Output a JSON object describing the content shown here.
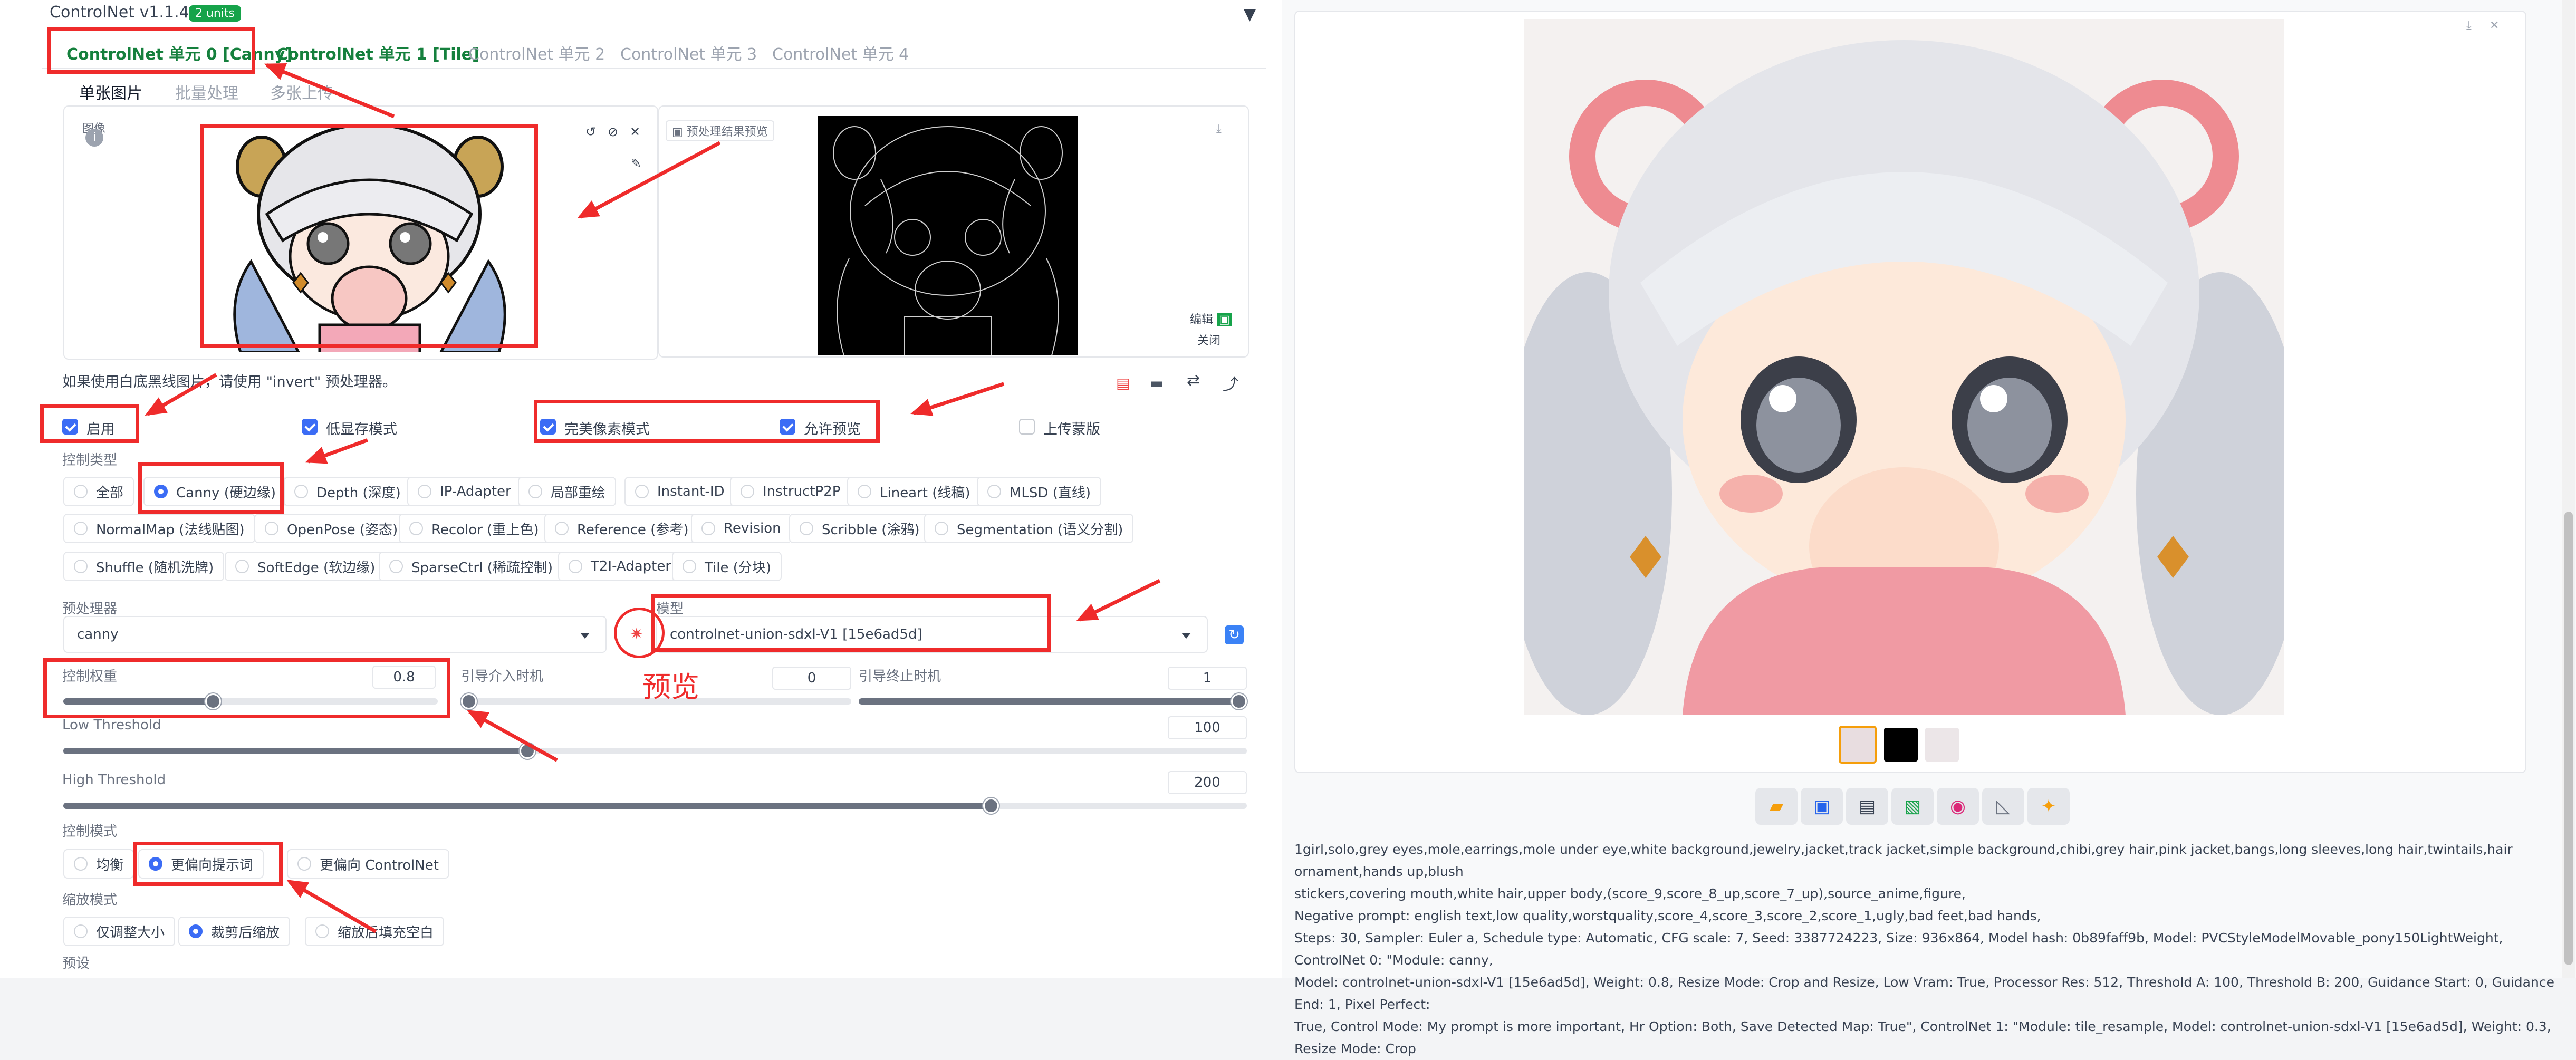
{
  "header": {
    "title": "ControlNet v1.1.445",
    "badge": "2 units"
  },
  "tabs": [
    {
      "label": "ControlNet 单元 0 [Canny]"
    },
    {
      "label": "ControlNet 单元 1 [Tile]"
    },
    {
      "label": "ControlNet 单元 2"
    },
    {
      "label": "ControlNet 单元 3"
    },
    {
      "label": "ControlNet 单元 4"
    }
  ],
  "subtabs": [
    {
      "label": "单张图片"
    },
    {
      "label": "批量处理"
    },
    {
      "label": "多张上传"
    }
  ],
  "image_area": {
    "input_label": "图像",
    "preview_label": "预处理结果预览",
    "edit_label": "编辑",
    "close_label": "关闭"
  },
  "invert_note": "如果使用白底黑线图片，请使用 \"invert\" 预处理器。",
  "checkboxes": [
    {
      "label": "启用",
      "checked": true
    },
    {
      "label": "低显存模式",
      "checked": true
    },
    {
      "label": "完美像素模式",
      "checked": true
    },
    {
      "label": "允许预览",
      "checked": true
    },
    {
      "label": "上传蒙版",
      "checked": false
    }
  ],
  "control_type": {
    "label": "控制类型",
    "rows": [
      [
        "全部",
        "Canny (硬边缘)",
        "Depth (深度)",
        "IP-Adapter",
        "局部重绘",
        "Instant-ID",
        "InstructP2P",
        "Lineart (线稿)",
        "MLSD (直线)"
      ],
      [
        "NormalMap (法线贴图)",
        "OpenPose (姿态)",
        "Recolor (重上色)",
        "Reference (参考)",
        "Revision",
        "Scribble (涂鸦)",
        "Segmentation (语义分割)"
      ],
      [
        "Shuffle (随机洗牌)",
        "SoftEdge (软边缘)",
        "SparseCtrl (稀疏控制)",
        "T2I-Adapter",
        "Tile (分块)"
      ]
    ],
    "selected": "Canny (硬边缘)"
  },
  "preprocessor": {
    "label": "预处理器",
    "value": "canny"
  },
  "model": {
    "label": "模型",
    "value": "controlnet-union-sdxl-V1 [15e6ad5d]"
  },
  "annotation": {
    "preview_text": "预览"
  },
  "sliders": {
    "weight": {
      "label": "控制权重",
      "value": "0.8",
      "fraction": 0.4
    },
    "start": {
      "label": "引导介入时机",
      "value": "0",
      "fraction": 0.0
    },
    "end": {
      "label": "引导终止时机",
      "value": "1",
      "fraction": 1.0
    },
    "low": {
      "label": "Low Threshold",
      "value": "100",
      "fraction": 0.392
    },
    "high": {
      "label": "High Threshold",
      "value": "200",
      "fraction": 0.784
    }
  },
  "control_mode": {
    "label": "控制模式",
    "options": [
      "均衡",
      "更偏向提示词",
      "更偏向 ControlNet"
    ],
    "selected": "更偏向提示词"
  },
  "resize_mode": {
    "label": "缩放模式",
    "options": [
      "仅调整大小",
      "裁剪后缩放",
      "缩放后填充空白"
    ],
    "selected": "裁剪后缩放"
  },
  "preset_label": "预设",
  "info": {
    "lines": [
      "1girl,solo,grey eyes,mole,earrings,mole under eye,white background,jewelry,jacket,track jacket,simple background,chibi,grey hair,pink jacket,bangs,long sleeves,long hair,twintails,hair ornament,hands up,blush",
      "stickers,covering mouth,white hair,upper body,(score_9,score_8_up,score_7_up),source_anime,figure,",
      "Negative prompt: english text,low quality,worstquality,score_4,score_3,score_2,score_1,ugly,bad feet,bad hands,",
      "Steps: 30, Sampler: Euler a, Schedule type: Automatic, CFG scale: 7, Seed: 3387724223, Size: 936x864, Model hash: 0b89faff9b, Model: PVCStyleModelMovable_pony150LightWeight, ControlNet 0: \"Module: canny,",
      "Model: controlnet-union-sdxl-V1 [15e6ad5d], Weight: 0.8, Resize Mode: Crop and Resize, Low Vram: True, Processor Res: 512, Threshold A: 100, Threshold B: 200, Guidance Start: 0, Guidance End: 1, Pixel Perfect:",
      "True, Control Mode: My prompt is more important, Hr Option: Both, Save Detected Map: True\", ControlNet 1: \"Module: tile_resample, Model: controlnet-union-sdxl-V1 [15e6ad5d], Weight: 0.3, Resize Mode: Crop"
    ]
  },
  "colors": {
    "accent": "#3b6cf5",
    "tab_active": "#15803d",
    "annotation_red": "#ef2b2b",
    "badge": "#16a34a"
  }
}
